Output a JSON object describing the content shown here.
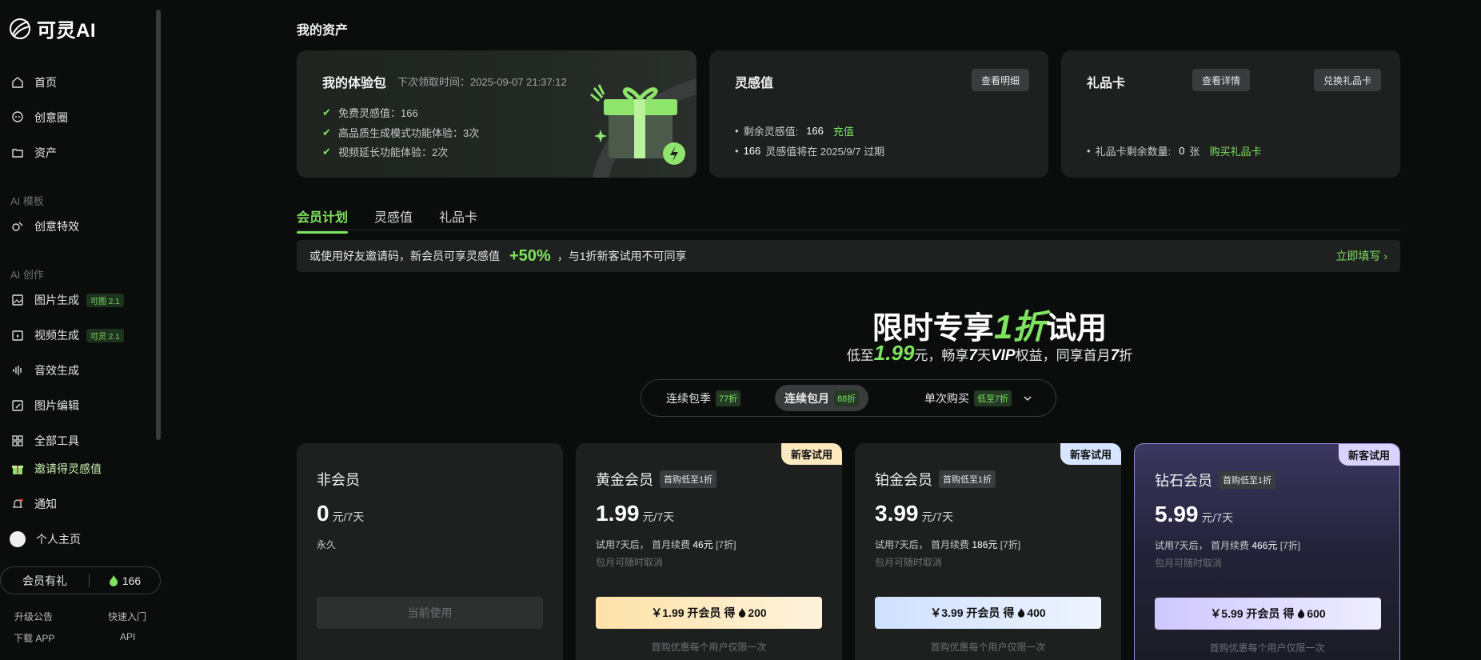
{
  "brand": {
    "name": "可灵AI"
  },
  "sidebar": {
    "nav": [
      {
        "label": "首页",
        "icon": "home-icon"
      },
      {
        "label": "创意圈",
        "icon": "community-icon"
      },
      {
        "label": "资产",
        "icon": "folder-icon"
      }
    ],
    "section_templates": "AI 模板",
    "templates": [
      {
        "label": "创意特效",
        "icon": "effects-icon"
      }
    ],
    "section_create": "AI 创作",
    "create": [
      {
        "label": "图片生成",
        "tag": "可图 2.1",
        "icon": "image-icon"
      },
      {
        "label": "视频生成",
        "tag": "可灵 2.1",
        "icon": "video-icon"
      },
      {
        "label": "音效生成",
        "icon": "sound-icon"
      },
      {
        "label": "图片编辑",
        "icon": "edit-image-icon"
      },
      {
        "label": "全部工具",
        "icon": "grid-icon"
      }
    ],
    "invite": "邀请得灵感值",
    "notify": "通知",
    "profile": "个人主页",
    "member_gift": "会员有礼",
    "credits": "166",
    "footer": {
      "updates": "升级公告",
      "quickstart": "快速入门",
      "download": "下载 APP",
      "api": "API"
    }
  },
  "main": {
    "title": "我的资产",
    "trial_card": {
      "title": "我的体验包",
      "next_time": "下次领取时间：2025-09-07 21:37:12",
      "items": [
        "免费灵感值：166",
        "高品质生成模式功能体验：3次",
        "视频延长功能体验：2次"
      ]
    },
    "credit_card": {
      "title": "灵感值",
      "btn": "查看明细",
      "remain_label": "剩余灵感值:",
      "remain_value": "166",
      "recharge": "充值",
      "expire_value": "166",
      "expire_text": "灵感值将在 2025/9/7 过期"
    },
    "gift_card": {
      "title": "礼品卡",
      "btn_detail": "查看详情",
      "btn_redeem": "兑换礼品卡",
      "count_label": "礼品卡剩余数量:",
      "count_value": "0",
      "count_unit": "张",
      "buy": "购买礼品卡"
    },
    "tabs": [
      "会员计划",
      "灵感值",
      "礼品卡"
    ],
    "invite_bar": {
      "text": "或使用好友邀请码，新会员可享灵感值",
      "pct": "+50%",
      "suffix": "，与1折新客试用不可同享",
      "cta": "立即填写 ›"
    },
    "promo": {
      "title_a": "限时专享",
      "title_b": "1折",
      "title_c": "试用",
      "sub_a": "低至",
      "sub_price": "1.99",
      "sub_b": "元，畅享",
      "sub_days": "7",
      "sub_c": "天",
      "sub_vip": "VIP",
      "sub_d": "权益，同享首月",
      "sub_discount": "7",
      "sub_e": "折"
    },
    "billing": [
      {
        "label": "连续包季",
        "badge": "77折"
      },
      {
        "label": "连续包月",
        "badge": "88折"
      },
      {
        "label": "单次购买",
        "badge": "低至7折"
      }
    ],
    "plans": [
      {
        "name": "非会员",
        "price": "0",
        "unit": "元/7天",
        "note": "永久",
        "btn": "当前使用"
      },
      {
        "name": "黄金会员",
        "badge": "新客试用",
        "tag": "首购低至1折",
        "price": "1.99",
        "unit": "元/7天",
        "note_a": "试用7天后，  首月续费",
        "note_price": "46元",
        "note_b": "[7折]",
        "note2": "包月可随时取消",
        "btn_a": "￥1.99 开会员  得",
        "btn_b": "200",
        "foot": "首购优惠每个用户仅限一次"
      },
      {
        "name": "铂金会员",
        "badge": "新客试用",
        "tag": "首购低至1折",
        "price": "3.99",
        "unit": "元/7天",
        "note_a": "试用7天后，  首月续费",
        "note_price": "186元",
        "note_b": "[7折]",
        "note2": "包月可随时取消",
        "btn_a": "￥3.99 开会员  得",
        "btn_b": "400",
        "foot": "首购优惠每个用户仅限一次"
      },
      {
        "name": "钻石会员",
        "badge": "新客试用",
        "tag": "首购低至1折",
        "price": "5.99",
        "unit": "元/7天",
        "note_a": "试用7天后，  首月续费",
        "note_price": "466元",
        "note_b": "[7折]",
        "note2": "包月可随时取消",
        "btn_a": "￥5.99 开会员  得",
        "btn_b": "600",
        "foot": "首购优惠每个用户仅限一次"
      }
    ]
  },
  "colors": {
    "accent": "#7fe35f",
    "bg": "#0b0c0c",
    "card": "#1e201f",
    "gold": "#fde9c0",
    "platinum": "#d7e6ff",
    "diamond": "#d9d4ff"
  }
}
